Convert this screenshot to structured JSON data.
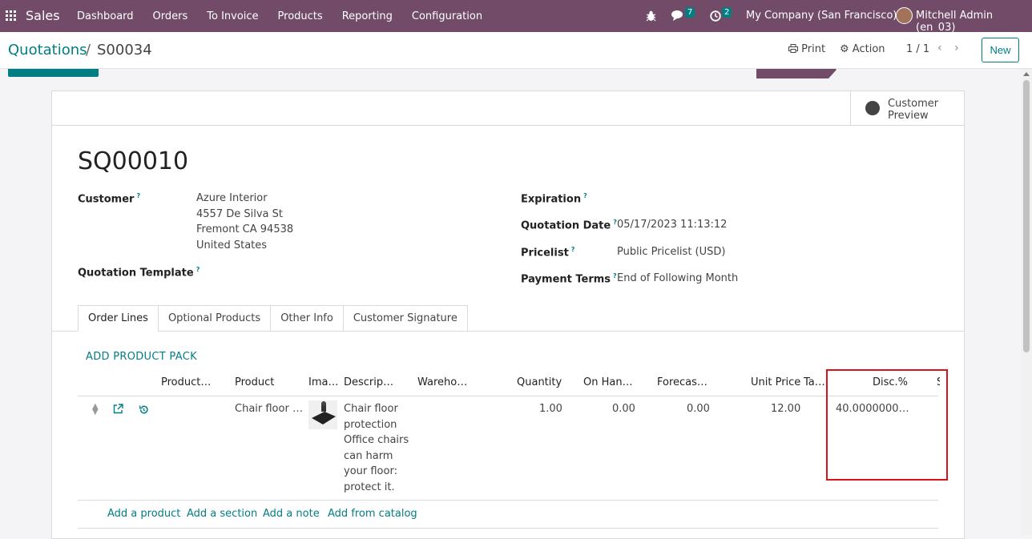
{
  "navbar": {
    "app_name": "Sales",
    "menu": [
      "Dashboard",
      "Orders",
      "To Invoice",
      "Products",
      "Reporting",
      "Configuration"
    ],
    "messages_count": "7",
    "activities_count": "2",
    "company": "My Company (San Francisco)",
    "user": "Mitchell Admin (en_03)"
  },
  "control_panel": {
    "breadcrumb_root": "Quotations",
    "breadcrumb_sep": "/",
    "breadcrumb_current": "S00034",
    "print_label": "Print",
    "action_label": "Action",
    "pager": "1 / 1",
    "new_label": "New"
  },
  "sheet": {
    "customer_preview": "Customer Preview",
    "title": "SQ00010",
    "customer_label": "Customer",
    "customer_lines": [
      "Azure Interior",
      "4557 De Silva St",
      "Fremont CA 94538",
      "United States"
    ],
    "template_label": "Quotation Template",
    "expiration_label": "Expiration",
    "quotation_date_label": "Quotation Date",
    "quotation_date": "05/17/2023 11:13:12",
    "pricelist_label": "Pricelist",
    "pricelist": "Public Pricelist (USD)",
    "payment_terms_label": "Payment Terms",
    "payment_terms": "End of Following Month",
    "help_mark": "?"
  },
  "tabs": [
    "Order Lines",
    "Optional Products",
    "Other Info",
    "Customer Signature"
  ],
  "order_lines": {
    "add_pack": "ADD PRODUCT PACK",
    "columns": [
      "Product…",
      "Product",
      "Ima…",
      "Descrip…",
      "Wareho…",
      "Quantity",
      "On Han…",
      "Forecas…",
      "Unit Price",
      "Ta…",
      "Disc.%",
      "S"
    ],
    "row": {
      "product": "Chair floor …",
      "description": "Chair floor protection Office chairs can harm your floor: protect it.",
      "quantity": "1.00",
      "on_hand": "0.00",
      "forecast": "0.00",
      "unit_price": "12.00",
      "discount": "40.0000000…"
    },
    "footer_links": [
      "Add a product",
      "Add a section",
      "Add a note",
      "Add from catalog"
    ]
  },
  "colors": {
    "brand": "#714b67",
    "accent": "#017e84",
    "highlight": "#d9111a"
  }
}
